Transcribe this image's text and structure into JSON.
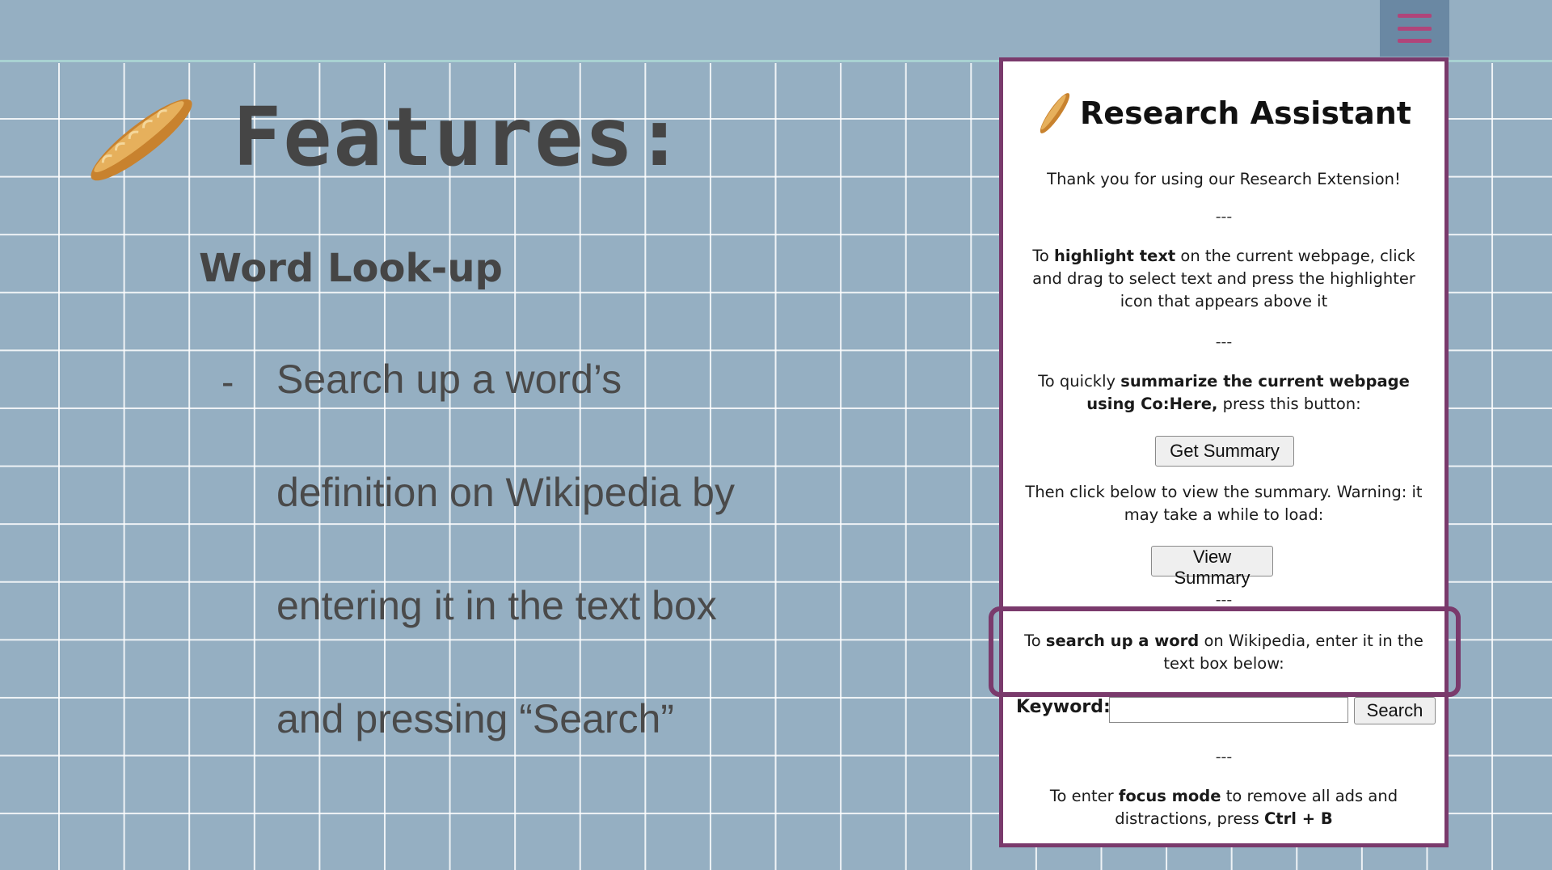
{
  "slide": {
    "title": "Features:",
    "subtitle": "Word Look-up",
    "bullet_marker": "-",
    "bullet_lines": [
      "Search up a word’s",
      "definition on Wikipedia by",
      "entering it in the text box",
      "and pressing “Search”"
    ]
  },
  "menu": {
    "icon": "hamburger-menu-icon",
    "color": "#b0457a"
  },
  "colors": {
    "background": "#95afc2",
    "accent": "#7a3a6c",
    "menu_bg": "#6a88a3"
  },
  "popup": {
    "title": "Research Assistant",
    "icon": "baguette-icon",
    "thank_you": "Thank you for using our Research Extension!",
    "separator": "---",
    "highlight": {
      "pre": "To ",
      "bold": "highlight text",
      "post": " on the current webpage, click and drag to select text and press the highlighter icon that appears above it"
    },
    "summary": {
      "pre": "To quickly ",
      "bold": "summarize the current webpage using Co:Here,",
      "post": " press this button:"
    },
    "get_summary_label": "Get Summary",
    "view_instructions": "Then click below to view the summary. Warning: it may take a while to load:",
    "view_summary_label": "View Summary",
    "search": {
      "pre": "To ",
      "bold": "search up a word",
      "post": " on Wikipedia, enter it in the text box below:"
    },
    "keyword_label": "Keyword:",
    "keyword_value": "",
    "search_label": "Search",
    "focus": {
      "pre": "To enter ",
      "bold": "focus mode",
      "mid": " to remove all ads and distractions, press ",
      "bold2": "Ctrl + B"
    }
  }
}
